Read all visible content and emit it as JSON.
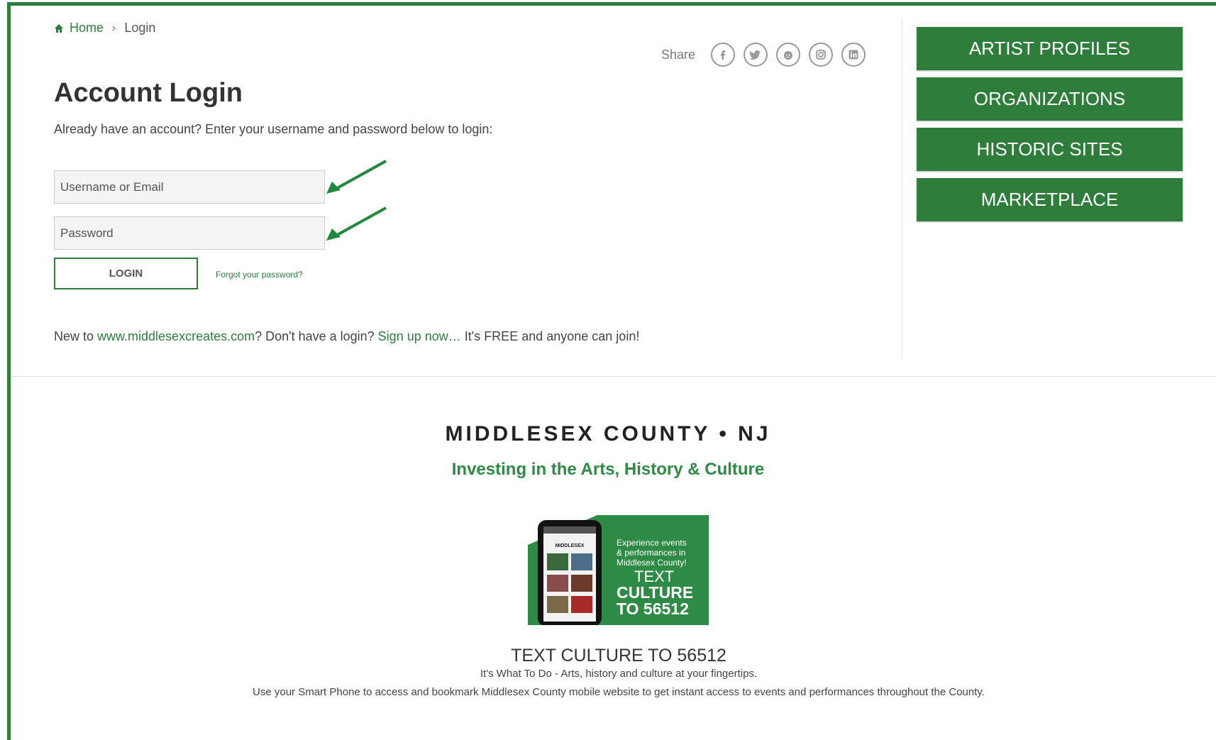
{
  "breadcrumb": {
    "home": "Home",
    "separator": "›",
    "current": "Login"
  },
  "share": {
    "label": "Share",
    "icons": [
      "facebook-icon",
      "twitter-icon",
      "reddit-icon",
      "instagram-icon",
      "linkedin-icon"
    ]
  },
  "login": {
    "title": "Account Login",
    "intro": "Already have an account? Enter your username and password below to login:",
    "username_placeholder": "Username or Email",
    "password_placeholder": "Password",
    "button": "LOGIN",
    "forgot": "Forgot your password?"
  },
  "signup": {
    "prefix": "New to ",
    "site_link": "www.middlesexcreates.com",
    "middle": "? Don't have a login? ",
    "signup_link": "Sign up now…",
    "suffix": " It's FREE and anyone can join!"
  },
  "sidebar": {
    "items": [
      "ARTIST PROFILES",
      "ORGANIZATIONS",
      "HISTORIC SITES",
      "MARKETPLACE"
    ]
  },
  "footer": {
    "county": "MIDDLESEX COUNTY • NJ",
    "tagline": "Investing in the Arts, History & Culture",
    "promo_image": {
      "phone_brand": "MIDDLESEX",
      "line1": "Experience events",
      "line2": "& performances in",
      "line3": "Middlesex County!",
      "text": "TEXT",
      "culture": "CULTURE",
      "to_number": "TO 56512"
    },
    "promo_title": "TEXT CULTURE TO 56512",
    "promo_sub": "It's What To Do - Arts, history and culture at your fingertips.",
    "promo_desc": "Use your Smart Phone to access and bookmark Middlesex County mobile website to get instant access to events and performances throughout the County."
  },
  "colors": {
    "brand_green": "#2e7d3a",
    "tagline_green": "#2e8b45"
  }
}
